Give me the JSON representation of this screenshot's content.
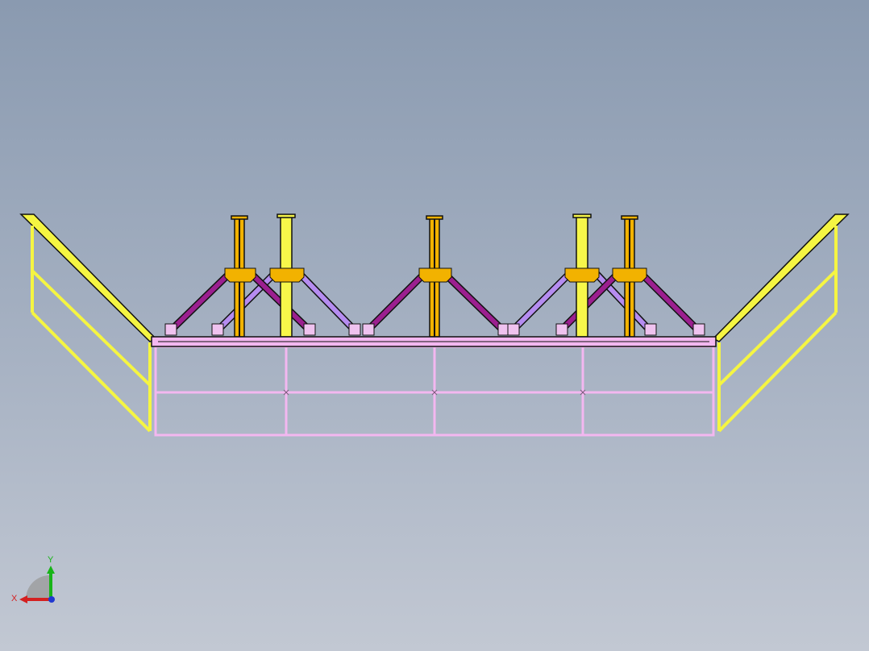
{
  "viewport": {
    "title": "",
    "background_top": "#8a9ab0",
    "background_bottom": "#c2c8d3"
  },
  "model": {
    "colors": {
      "railing": "#f5f542",
      "railing_outline": "#6b6b20",
      "column_yellow": "#f7f74a",
      "column_orange": "#f2b200",
      "brace_dark": "#9b1f8f",
      "brace_light": "#b58cf0",
      "deck": "#f3b7f0",
      "grid": "#f3b7f0",
      "plate": "#f2b200",
      "clip": "#efc2ef",
      "outline": "#111111"
    }
  },
  "triad": {
    "x_label": "X",
    "y_label": "Y",
    "x_color": "#d42020",
    "y_color": "#18b418",
    "z_color": "#2038d0"
  }
}
